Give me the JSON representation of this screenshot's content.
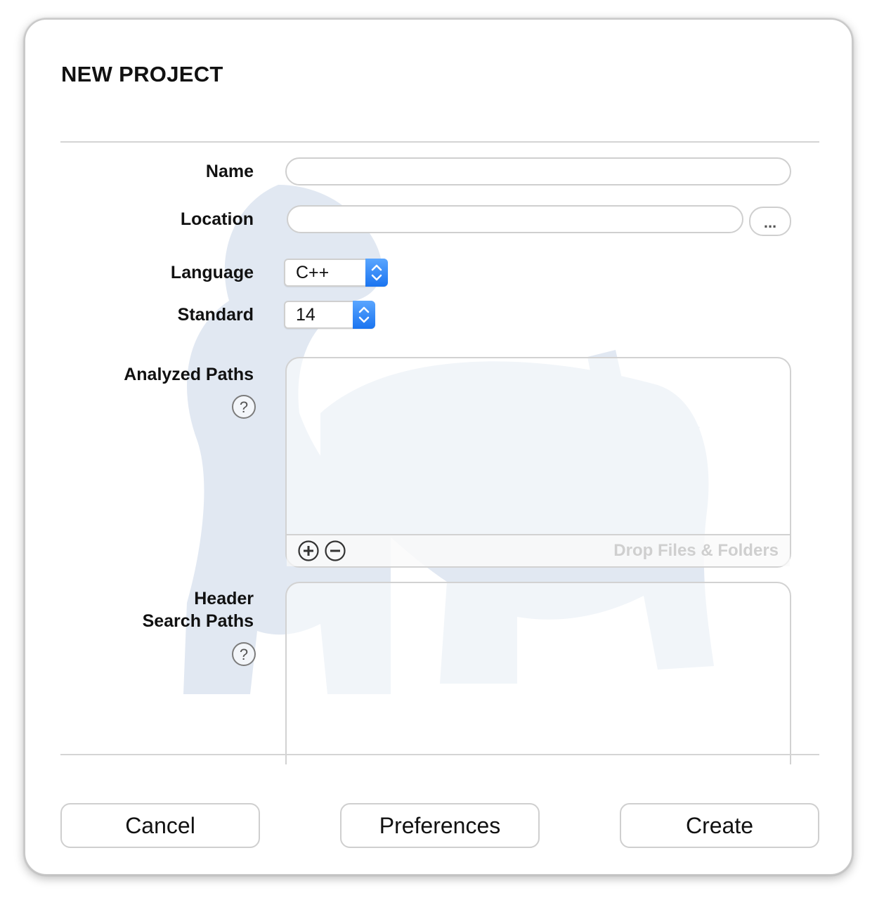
{
  "dialog": {
    "title": "NEW PROJECT"
  },
  "form": {
    "name": {
      "label": "Name",
      "value": ""
    },
    "location": {
      "label": "Location",
      "value": "",
      "browse_label": "..."
    },
    "language": {
      "label": "Language",
      "selected": "C++"
    },
    "standard": {
      "label": "Standard",
      "selected": "14"
    },
    "analyzed_paths": {
      "label": "Analyzed Paths",
      "help_glyph": "?",
      "drop_hint": "Drop Files & Folders",
      "items": []
    },
    "header_search_paths": {
      "label_line1": "Header",
      "label_line2": "Search Paths",
      "help_glyph": "?",
      "items": []
    }
  },
  "buttons": {
    "cancel": "Cancel",
    "preferences": "Preferences",
    "create": "Create"
  },
  "colors": {
    "accent": "#1a74f0",
    "watermark": "#c9d6e8",
    "border": "#cfcfcf"
  },
  "icons": [
    "ellipsis-icon",
    "chevron-updown-icon",
    "help-icon",
    "plus-circle-icon",
    "minus-circle-icon"
  ]
}
